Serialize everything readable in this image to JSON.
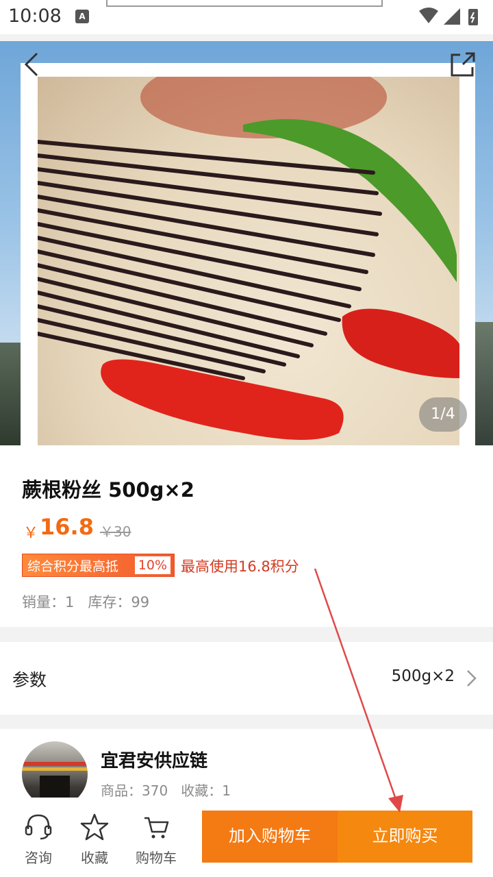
{
  "status_bar": {
    "time": "10:08",
    "notification_icon": "a-icon"
  },
  "hero": {
    "image_counter": "1/4",
    "back_icon": "back-icon",
    "share_icon": "share-icon"
  },
  "product": {
    "title": "蕨根粉丝 500g×2",
    "price_symbol": "￥",
    "price": "16.8",
    "original_price": "￥30",
    "points_badge_label": "综合积分最高抵",
    "points_badge_percent": "10%",
    "points_note": "最高使用16.8积分",
    "sales_stock": "销量：1   库存：99"
  },
  "params": {
    "label": "参数",
    "value": "500g×2"
  },
  "shop": {
    "name": "宜君安供应链",
    "stats": "商品：370   收藏：1"
  },
  "bottom_bar": {
    "consult_label": "咨询",
    "favorite_label": "收藏",
    "cart_label": "购物车",
    "add_to_cart_label": "加入购物车",
    "buy_now_label": "立即购买"
  },
  "colors": {
    "accent_orange": "#f47a14",
    "price_orange": "#f36a12",
    "annotation_red": "#e04848"
  }
}
